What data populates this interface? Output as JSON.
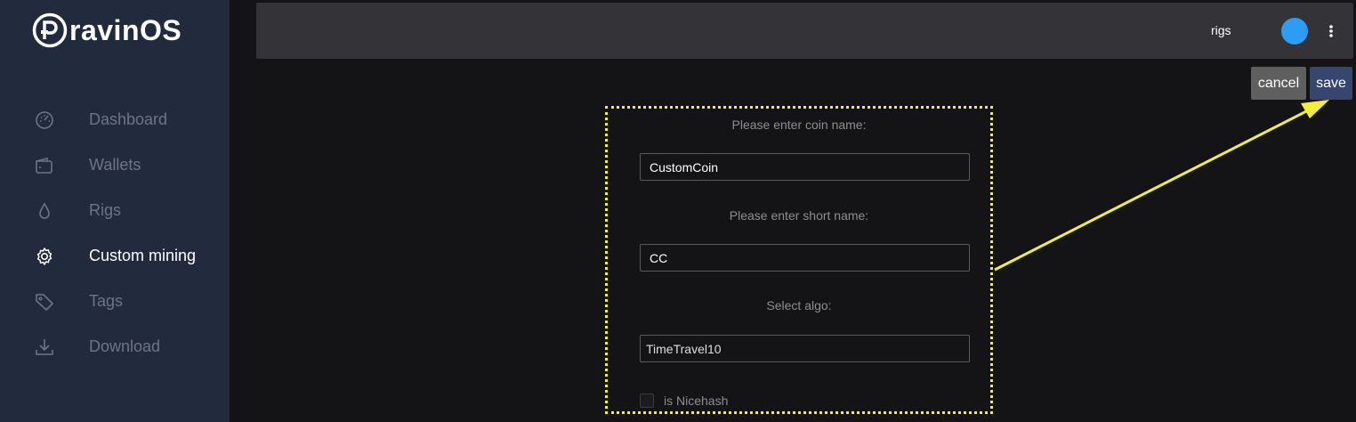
{
  "brand": {
    "name": "ravinOS",
    "logo_icon": "ravinos-r-logo"
  },
  "sidebar": {
    "items": [
      {
        "label": "Dashboard",
        "icon": "gauge-icon",
        "active": false
      },
      {
        "label": "Wallets",
        "icon": "wallet-icon",
        "active": false
      },
      {
        "label": "Rigs",
        "icon": "drop-icon",
        "active": false
      },
      {
        "label": "Custom mining",
        "icon": "gear-icon",
        "active": true
      },
      {
        "label": "Tags",
        "icon": "tag-icon",
        "active": false
      },
      {
        "label": "Download",
        "icon": "download-icon",
        "active": false
      }
    ]
  },
  "topbar": {
    "rigs_label": "rigs",
    "avatar_color": "#2d9cf5",
    "menu_icon": "kebab-menu-icon"
  },
  "actions": {
    "cancel_label": "cancel",
    "save_label": "save"
  },
  "form": {
    "coin_name_label": "Please enter coin name:",
    "coin_name_value": "CustomCoin",
    "short_name_label": "Please enter short name:",
    "short_name_value": "CC",
    "algo_label": "Select algo:",
    "algo_value": "TimeTravel10",
    "nicehash_label": "is Nicehash",
    "nicehash_checked": false
  },
  "colors": {
    "sidebar_bg": "#222a3d",
    "page_bg": "#141416",
    "topbar_bg": "#333338",
    "save_bg": "#37466e",
    "cancel_bg": "#5f5f5f",
    "highlight": "#f2ef3a"
  }
}
